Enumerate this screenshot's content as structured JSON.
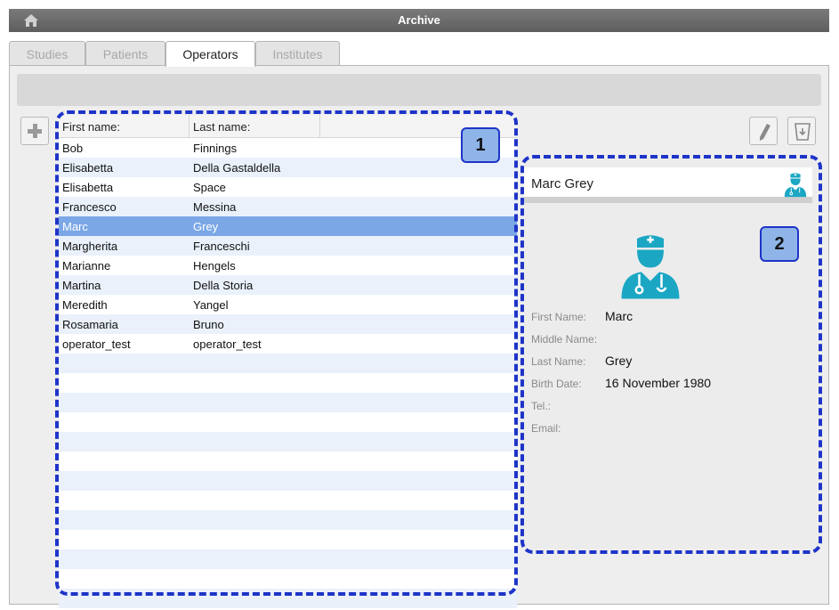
{
  "window": {
    "title": "Archive",
    "home_icon": "home-icon"
  },
  "tabs": [
    {
      "label": "Studies",
      "active": false
    },
    {
      "label": "Patients",
      "active": false
    },
    {
      "label": "Operators",
      "active": true
    },
    {
      "label": "Institutes",
      "active": false
    }
  ],
  "toolbar": {
    "add_icon": "plus-icon",
    "edit_icon": "pencil-icon",
    "delete_icon": "trash-icon"
  },
  "list": {
    "columns": [
      "First name:",
      "Last name:"
    ],
    "rows": [
      {
        "first": "Bob",
        "last": "Finnings"
      },
      {
        "first": "Elisabetta",
        "last": "Della Gastaldella"
      },
      {
        "first": "Elisabetta",
        "last": "Space"
      },
      {
        "first": "Francesco",
        "last": "Messina"
      },
      {
        "first": "Marc",
        "last": "Grey",
        "selected": true
      },
      {
        "first": "Margherita",
        "last": "Franceschi"
      },
      {
        "first": "Marianne",
        "last": "Hengels"
      },
      {
        "first": "Martina",
        "last": "Della Storia"
      },
      {
        "first": "Meredith",
        "last": "Yangel"
      },
      {
        "first": "Rosamaria",
        "last": "Bruno"
      },
      {
        "first": "operator_test",
        "last": "operator_test"
      }
    ]
  },
  "annotations": {
    "badge1": "1",
    "badge2": "2",
    "color": "#1e34c8"
  },
  "details": {
    "title": "Marc Grey",
    "icon": "doctor-icon",
    "icon_color": "#1ba7c4",
    "fields": [
      {
        "label": "First Name:",
        "value": "Marc"
      },
      {
        "label": "Middle Name:",
        "value": ""
      },
      {
        "label": "Last Name:",
        "value": "Grey"
      },
      {
        "label": "Birth Date:",
        "value": "16 November 1980"
      },
      {
        "label": "Tel.:",
        "value": ""
      },
      {
        "label": "Email:",
        "value": ""
      }
    ]
  }
}
